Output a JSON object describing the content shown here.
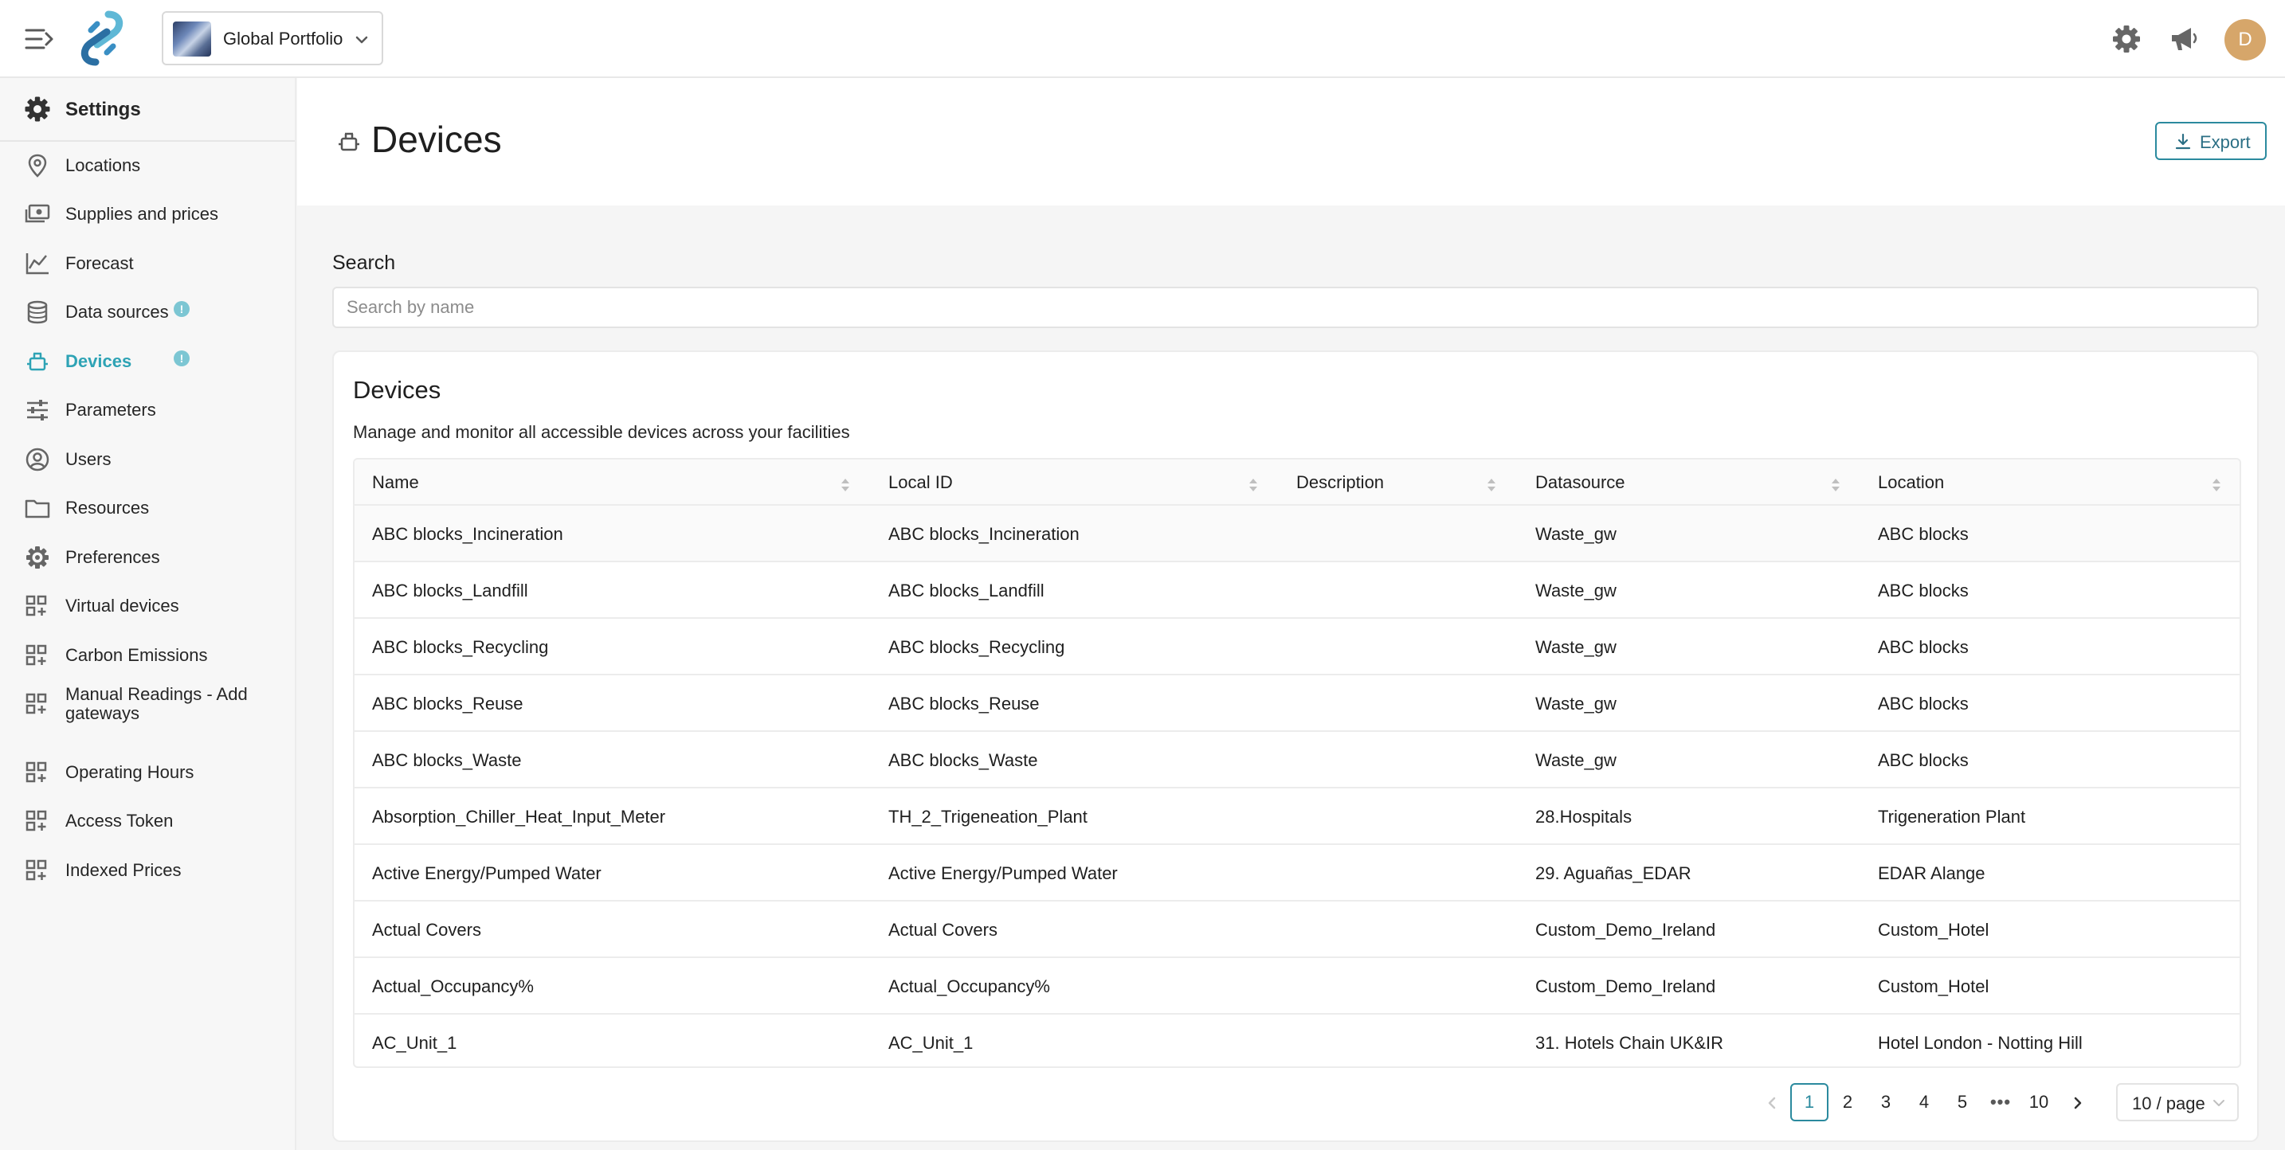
{
  "topbar": {
    "portfolio_label": "Global Portfolio",
    "avatar_initial": "D",
    "accent_color": "#2ea3b5"
  },
  "sidebar": {
    "header": "Settings",
    "items": [
      {
        "label": "Locations",
        "icon": "map-pin-icon"
      },
      {
        "label": "Supplies and prices",
        "icon": "money-icon"
      },
      {
        "label": "Forecast",
        "icon": "chart-line-icon"
      },
      {
        "label": "Data sources",
        "icon": "database-icon",
        "badge": "!"
      },
      {
        "label": "Devices",
        "icon": "device-icon",
        "badge": "!",
        "active": true
      },
      {
        "label": "Parameters",
        "icon": "sliders-icon"
      },
      {
        "label": "Users",
        "icon": "user-circle-icon"
      },
      {
        "label": "Resources",
        "icon": "folder-icon"
      },
      {
        "label": "Preferences",
        "icon": "gear-icon"
      },
      {
        "label": "Virtual devices",
        "icon": "grid-plus-icon"
      },
      {
        "label": "Carbon Emissions",
        "icon": "grid-plus-icon"
      },
      {
        "label": "Manual Readings - Add gateways",
        "icon": "grid-plus-icon"
      },
      {
        "label": "Operating Hours",
        "icon": "grid-plus-icon"
      },
      {
        "label": "Access Token",
        "icon": "grid-plus-icon"
      },
      {
        "label": "Indexed Prices",
        "icon": "grid-plus-icon"
      }
    ]
  },
  "page": {
    "title": "Devices",
    "export_label": "Export"
  },
  "search": {
    "title": "Search",
    "placeholder": "Search by name"
  },
  "card": {
    "title": "Devices",
    "subtitle": "Manage and monitor all accessible devices across your facilities"
  },
  "table": {
    "columns": [
      "Name",
      "Local ID",
      "Description",
      "Datasource",
      "Location"
    ],
    "rows": [
      [
        "ABC blocks_Incineration",
        "ABC blocks_Incineration",
        "",
        "Waste_gw",
        "ABC blocks"
      ],
      [
        "ABC blocks_Landfill",
        "ABC blocks_Landfill",
        "",
        "Waste_gw",
        "ABC blocks"
      ],
      [
        "ABC blocks_Recycling",
        "ABC blocks_Recycling",
        "",
        "Waste_gw",
        "ABC blocks"
      ],
      [
        "ABC blocks_Reuse",
        "ABC blocks_Reuse",
        "",
        "Waste_gw",
        "ABC blocks"
      ],
      [
        "ABC blocks_Waste",
        "ABC blocks_Waste",
        "",
        "Waste_gw",
        "ABC blocks"
      ],
      [
        "Absorption_Chiller_Heat_Input_Meter",
        "TH_2_Trigeneation_Plant",
        "",
        "28.Hospitals",
        "Trigeneration Plant"
      ],
      [
        "Active Energy/Pumped Water",
        "Active Energy/Pumped Water",
        "",
        "29. Aguañas_EDAR",
        "EDAR Alange"
      ],
      [
        "Actual Covers",
        "Actual Covers",
        "",
        "Custom_Demo_Ireland",
        "Custom_Hotel"
      ],
      [
        "Actual_Occupancy%",
        "Actual_Occupancy%",
        "",
        "Custom_Demo_Ireland",
        "Custom_Hotel"
      ],
      [
        "AC_Unit_1",
        "AC_Unit_1",
        "",
        "31. Hotels Chain UK&IR",
        "Hotel London - Notting Hill"
      ]
    ]
  },
  "pagination": {
    "pages": [
      "1",
      "2",
      "3",
      "4",
      "5",
      "•••",
      "10"
    ],
    "current": "1",
    "page_size": "10 / page"
  }
}
